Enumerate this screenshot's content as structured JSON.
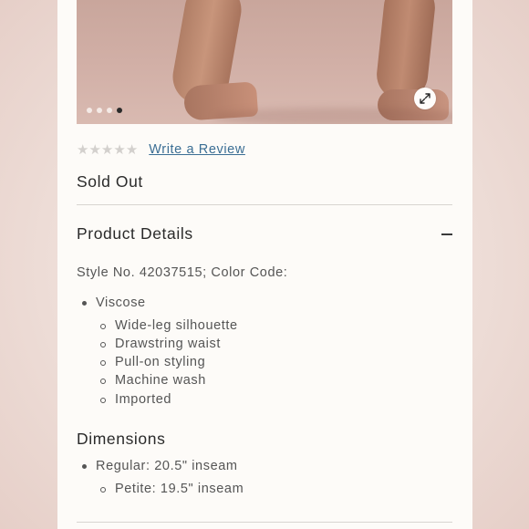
{
  "gallery": {
    "slide_count": 4,
    "active_slide": 4,
    "zoom_icon": "expand-arrows-icon"
  },
  "rating": {
    "stars_filled": 0,
    "stars_total": 5,
    "review_link": "Write a Review"
  },
  "availability": "Sold Out",
  "product_details": {
    "title": "Product Details",
    "toggle_icon": "minus-icon",
    "style_line": "Style No. 42037515; Color Code:",
    "material": "Viscose",
    "features": [
      "Wide-leg silhouette",
      "Drawstring waist",
      "Pull-on styling",
      "Machine wash",
      "Imported"
    ]
  },
  "dimensions": {
    "title": "Dimensions",
    "regular": "Regular: 20.5\" inseam",
    "petite": "Petite: 19.5\" inseam"
  },
  "colors": {
    "link": "#3b6e94",
    "text": "#2a2a2a",
    "muted": "#555555",
    "star_empty": "#d3d0cd"
  }
}
